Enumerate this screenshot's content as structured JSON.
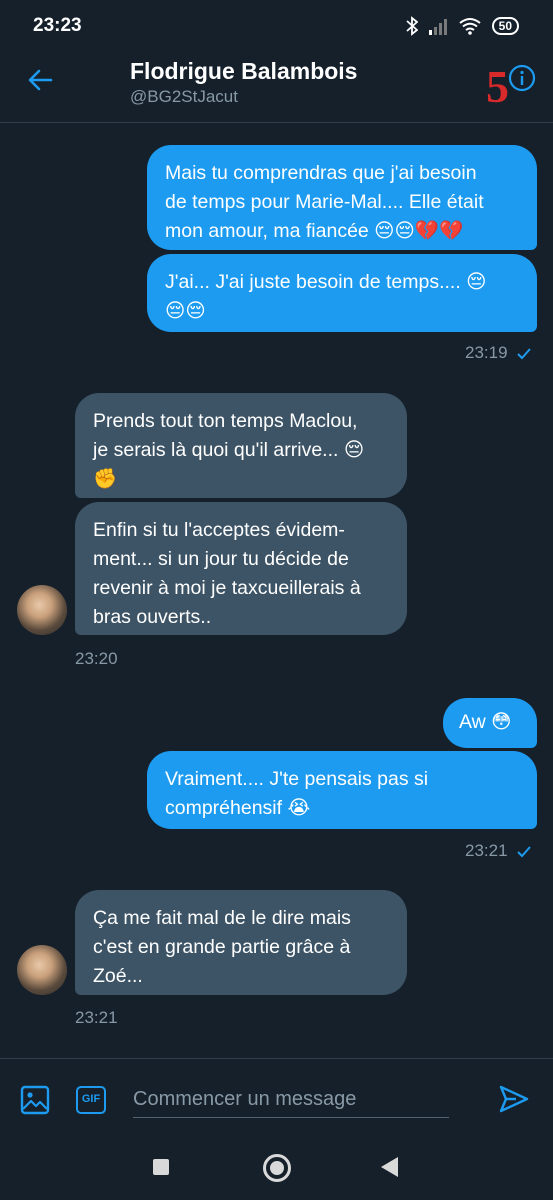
{
  "status_bar": {
    "time": "23:23",
    "battery": "50"
  },
  "header": {
    "name": "Flodrigue Balambois",
    "handle": "@BG2StJacut",
    "counter": "5"
  },
  "messages": [
    {
      "side": "sent",
      "text": "Mais tu comprendras que j'ai besoin\nde temps pour Marie-Mal.... Elle était\nmon amour, ma fiancée 😔😔💔💔"
    },
    {
      "side": "sent",
      "text": "J'ai... J'ai juste besoin de temps.... 😔\n😔😔"
    },
    {
      "side": "sent_time",
      "text": "23:19"
    },
    {
      "side": "received",
      "text": "Prends tout ton temps Maclou,\nje serais là quoi qu'il arrive... 😔\n✊"
    },
    {
      "side": "received",
      "text": "Enfin si tu l'acceptes évidem-\nment... si un jour tu décide de\nrevenir à moi je taxcueillerais à\nbras ouverts.."
    },
    {
      "side": "received_time",
      "text": "23:20"
    },
    {
      "side": "sent",
      "text": "Aw 😳"
    },
    {
      "side": "sent",
      "text": "Vraiment.... J'te pensais pas si\ncompréhensif 😭"
    },
    {
      "side": "sent_time",
      "text": "23:21"
    },
    {
      "side": "received",
      "text": "Ça me fait mal de le dire mais\nc'est en grande partie grâce à\nZoé..."
    },
    {
      "side": "received_time",
      "text": "23:21"
    }
  ],
  "composer": {
    "placeholder": "Commencer un message",
    "gif_label": "GIF"
  },
  "icons": {
    "back": "arrow-left-icon",
    "info": "info-icon",
    "media": "image-icon",
    "gif": "gif-icon",
    "send": "send-icon"
  },
  "colors": {
    "background": "#15202b",
    "sent_bubble": "#1d9bf0",
    "received_bubble": "#3d5466",
    "accent": "#1d9bf0",
    "muted_text": "#8899a6",
    "counter": "#d82a2a"
  }
}
